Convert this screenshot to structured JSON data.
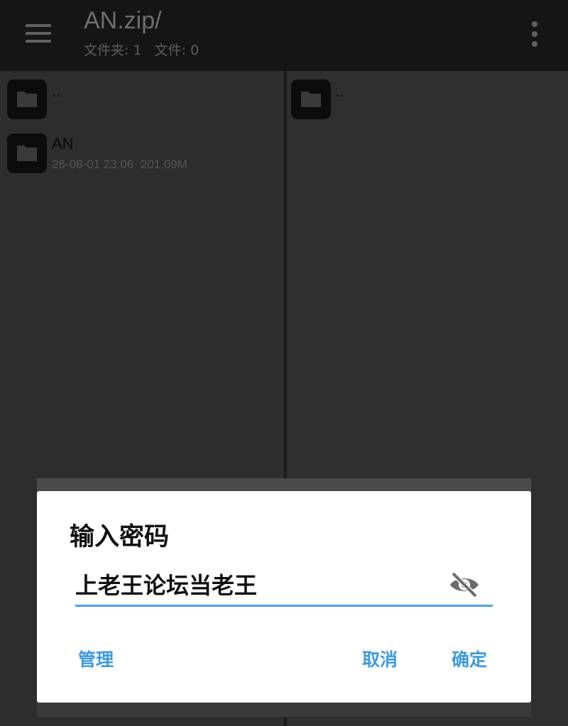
{
  "toolbar": {
    "title": "AN.zip/",
    "subtitle": "文件夹: 1   文件: 0"
  },
  "left_pane": {
    "items": [
      {
        "name": "..",
        "meta": ""
      },
      {
        "name": "AN",
        "meta": "26-08-01 23:06  201.09M"
      }
    ]
  },
  "right_pane": {
    "items": [
      {
        "name": ".."
      }
    ]
  },
  "dialog": {
    "title": "输入密码",
    "password_value": "上老王论坛当老王",
    "visibility_icon": "eye-off-icon",
    "manage_label": "管理",
    "cancel_label": "取消",
    "ok_label": "确定"
  },
  "colors": {
    "accent": "#3d9ae0",
    "appbar": "#151515",
    "background": "#2e2e2e"
  }
}
